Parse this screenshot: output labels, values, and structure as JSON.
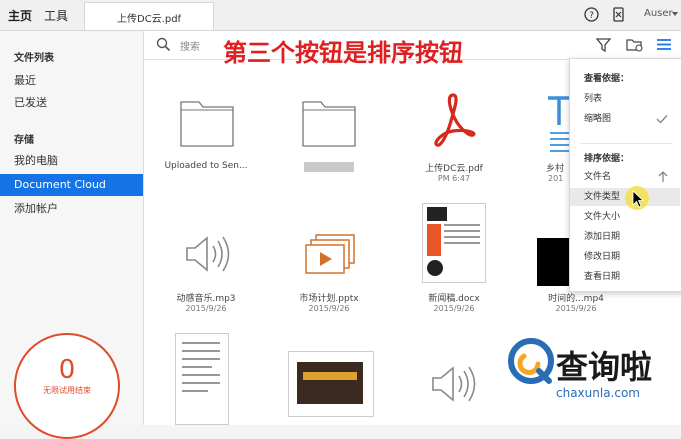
{
  "topbar": {
    "home_label": "主页",
    "tools_label": "工具",
    "doc_tab_label": "上传DC云.pdf",
    "user_label": "Auser"
  },
  "sidebar": {
    "section_files": "文件列表",
    "items_files": [
      {
        "label": "最近"
      },
      {
        "label": "已发送"
      }
    ],
    "section_storage": "存储",
    "items_storage": [
      {
        "label": "我的电脑"
      },
      {
        "label": "Document Cloud"
      },
      {
        "label": "添加帐户"
      }
    ],
    "trial_count": "0",
    "trial_text": "无限试用结束"
  },
  "main": {
    "search_placeholder": "搜索",
    "banner_text": "第三个按钮是排序按钮",
    "files": [
      {
        "name": "Uploaded to Sen...",
        "date": ""
      },
      {
        "name": "",
        "date": ""
      },
      {
        "name": "上传DC云.pdf",
        "date": "PM 6:47"
      },
      {
        "name": "乡村",
        "date": "201"
      },
      {
        "name": "动感音乐.mp3",
        "date": "2015/9/26"
      },
      {
        "name": "市场计划.pptx",
        "date": "2015/9/26"
      },
      {
        "name": "新闻稿.docx",
        "date": "2015/9/26"
      },
      {
        "name": "时间的...mp4",
        "date": "2015/9/26"
      }
    ]
  },
  "menu": {
    "view_by_label": "查看依据：",
    "view_items": [
      {
        "label": "列表"
      },
      {
        "label": "缩略图"
      }
    ],
    "sort_by_label": "排序依据：",
    "sort_items": [
      {
        "label": "文件名"
      },
      {
        "label": "文件类型"
      },
      {
        "label": "文件大小"
      },
      {
        "label": "添加日期"
      },
      {
        "label": "修改日期"
      },
      {
        "label": "查看日期"
      }
    ]
  },
  "watermark": {
    "text": "查询啦",
    "url": "chaxunla.com"
  },
  "colors": {
    "accent": "#1473e6",
    "banner": "#e02020",
    "acrobat_red": "#d7281c",
    "pptx_orange": "#d0722c"
  },
  "icons": [
    "help-icon",
    "phone-icon",
    "search-icon",
    "filter-icon",
    "folder-settings-icon",
    "menu-icon",
    "folder-icon",
    "pdf-icon",
    "audio-icon",
    "pptx-icon",
    "check-icon",
    "sort-arrow-icon",
    "cursor-icon"
  ]
}
